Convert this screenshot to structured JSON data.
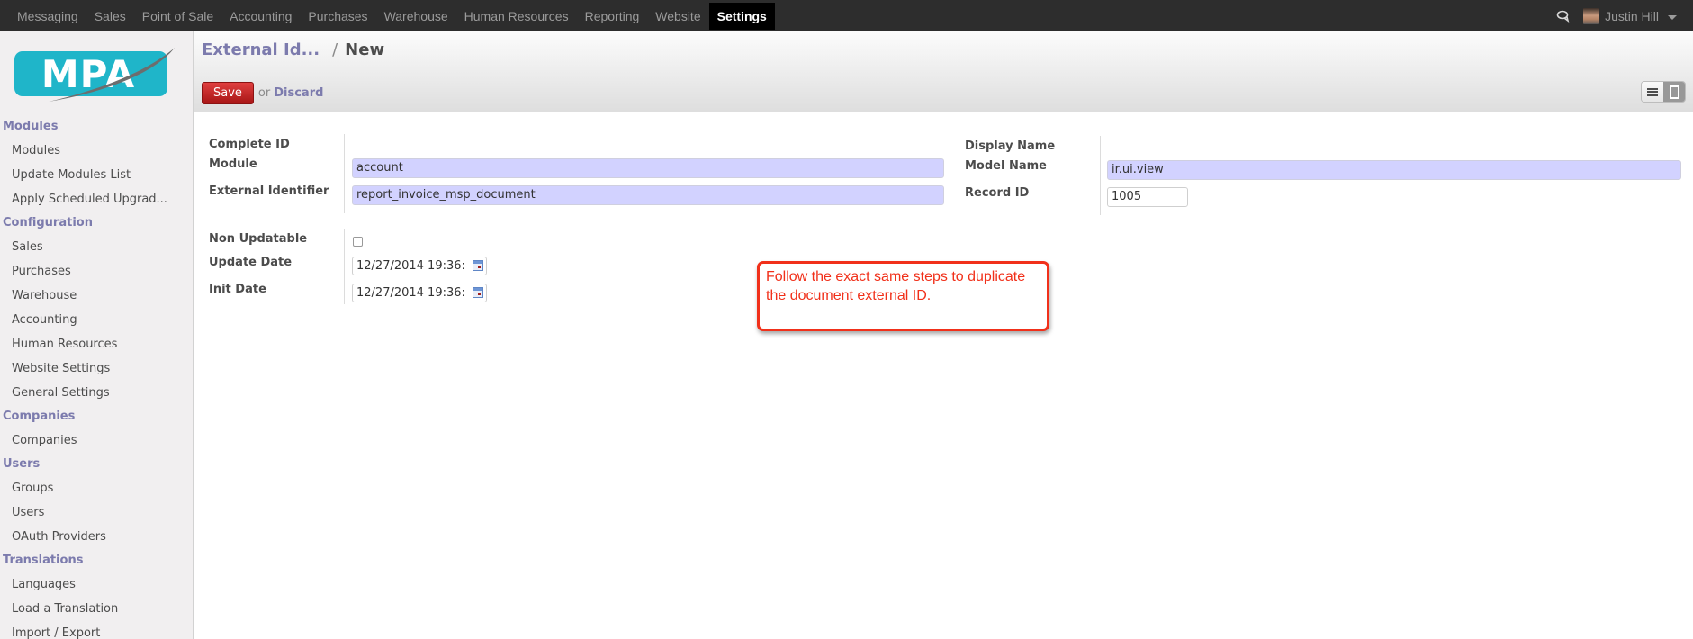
{
  "topbar": {
    "menu": [
      {
        "label": "Messaging",
        "active": false
      },
      {
        "label": "Sales",
        "active": false
      },
      {
        "label": "Point of Sale",
        "active": false
      },
      {
        "label": "Accounting",
        "active": false
      },
      {
        "label": "Purchases",
        "active": false
      },
      {
        "label": "Warehouse",
        "active": false
      },
      {
        "label": "Human Resources",
        "active": false
      },
      {
        "label": "Reporting",
        "active": false
      },
      {
        "label": "Website",
        "active": false
      },
      {
        "label": "Settings",
        "active": true
      }
    ],
    "user_name": "Justin Hill",
    "icons": {
      "chat": "chat-bubbles-icon",
      "user_menu": "caret-down-icon"
    }
  },
  "logo": {
    "text": "MPA",
    "bg_color": "#1fb5c9"
  },
  "sidebar": {
    "sections": [
      {
        "title": "Modules",
        "items": [
          "Modules",
          "Update Modules List",
          "Apply Scheduled Upgrad..."
        ]
      },
      {
        "title": "Configuration",
        "items": [
          "Sales",
          "Purchases",
          "Warehouse",
          "Accounting",
          "Human Resources",
          "Website Settings",
          "General Settings"
        ]
      },
      {
        "title": "Companies",
        "items": [
          "Companies"
        ]
      },
      {
        "title": "Users",
        "items": [
          "Groups",
          "Users",
          "OAuth Providers"
        ]
      },
      {
        "title": "Translations",
        "items": [
          "Languages",
          "Load a Translation",
          "Import / Export"
        ]
      }
    ]
  },
  "header": {
    "breadcrumb_parent": "External Id...",
    "breadcrumb_sep": "/",
    "breadcrumb_current": "New",
    "save_label": "Save",
    "or_label": "or",
    "discard_label": "Discard",
    "view_modes": [
      "list",
      "form"
    ],
    "active_view": "form"
  },
  "form": {
    "left": {
      "complete_id_label": "Complete ID",
      "complete_id_value": "",
      "module_label": "Module",
      "module_value": "account",
      "external_identifier_label": "External Identifier",
      "external_identifier_value": "report_invoice_msp_document",
      "non_updatable_label": "Non Updatable",
      "non_updatable_checked": false,
      "update_date_label": "Update Date",
      "update_date_value": "12/27/2014 19:36:",
      "init_date_label": "Init Date",
      "init_date_value": "12/27/2014 19:36:"
    },
    "right": {
      "display_name_label": "Display Name",
      "display_name_value": "",
      "model_name_label": "Model Name",
      "model_name_value": "ir.ui.view",
      "record_id_label": "Record ID",
      "record_id_value": "1005"
    }
  },
  "callout": {
    "text": "Follow the exact same steps to duplicate the document external ID.",
    "color": "#f1301a"
  },
  "colors": {
    "topbar_bg": "#2d2d2d",
    "accent": "#7c7bad",
    "save_button": "#c42424",
    "required_field": "#d2d2ff"
  }
}
